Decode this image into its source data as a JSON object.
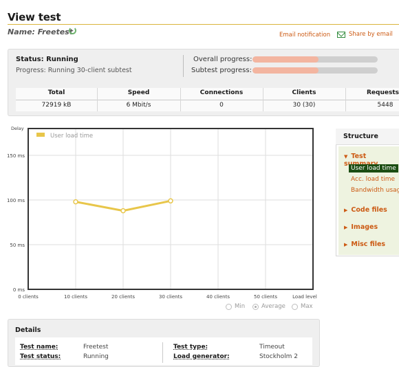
{
  "header": {
    "title": "View test",
    "name_label": "Name:",
    "name_value": "Freetest",
    "email_notification": "Email notification",
    "share_by_email": "Share by email"
  },
  "status": {
    "status_text": "Status: Running",
    "progress_text": "Progress: Running 30-client subtest",
    "overall_label": "Overall progress:",
    "subtest_label": "Subtest progress:",
    "overall_progress": 0.53,
    "subtest_progress": 0.53
  },
  "stats": {
    "columns": [
      "Total",
      "Speed",
      "Connections",
      "Clients",
      "Requests"
    ],
    "values": [
      "72919 kB",
      "6 Mbit/s",
      "0",
      "30 (30)",
      "5448"
    ]
  },
  "chart_data": {
    "type": "line",
    "ylabel": "Delay",
    "xlabel": "Load level",
    "ylim": [
      0,
      180
    ],
    "y_ticks": [
      "0 ms",
      "50 ms",
      "100 ms",
      "150 ms"
    ],
    "y_tick_values": [
      0,
      50,
      100,
      150
    ],
    "categories": [
      "0 clients",
      "10 clients",
      "20 clients",
      "30 clients",
      "40 clients",
      "50 clients"
    ],
    "x_axis_end_label": "Load level",
    "series": [
      {
        "name": "User load time",
        "color": "#e8c64a",
        "x": [
          "10 clients",
          "20 clients",
          "30 clients"
        ],
        "values": [
          98,
          88,
          99
        ]
      }
    ],
    "legend_placement": "top-left",
    "grid": true
  },
  "chart_options": {
    "min": "Min",
    "average": "Average",
    "max": "Max",
    "selected": "Average"
  },
  "structure": {
    "title": "Structure",
    "sections": [
      {
        "label": "Test summary",
        "expanded": true,
        "items": [
          {
            "label": "User load time",
            "active": true
          },
          {
            "label": "Acc. load time",
            "active": false
          },
          {
            "label": "Bandwidth usage",
            "active": false
          }
        ]
      },
      {
        "label": "Code files",
        "expanded": false
      },
      {
        "label": "Images",
        "expanded": false
      },
      {
        "label": "Misc files",
        "expanded": false
      }
    ]
  },
  "details": {
    "title": "Details",
    "rows": [
      {
        "label": "Test name:",
        "value": "Freetest"
      },
      {
        "label": "Test status:",
        "value": "Running"
      },
      {
        "label": "Test type:",
        "value": "Timeout"
      },
      {
        "label": "Load generator:",
        "value": "Stockholm 2"
      }
    ]
  },
  "colors": {
    "accent": "#cc5a13",
    "title_rule": "#d9b43a",
    "progress_fill": "#f3b5a0",
    "series": "#e8c64a",
    "active_item": "#1b4d12"
  }
}
